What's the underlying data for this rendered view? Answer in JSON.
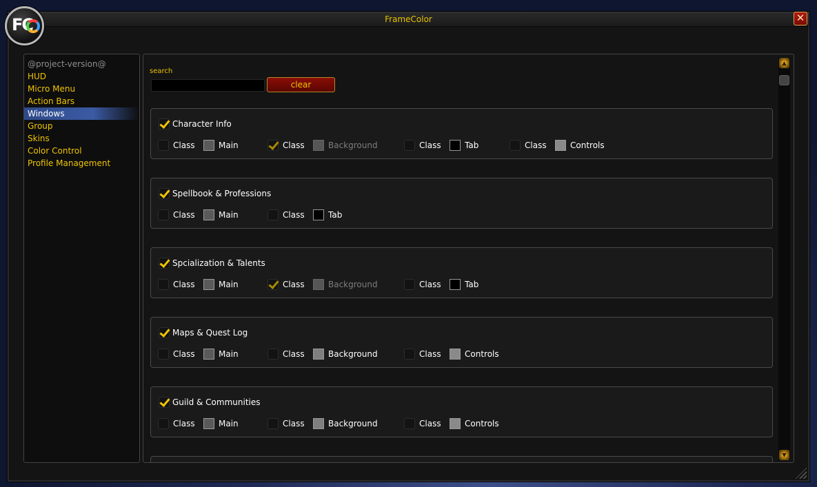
{
  "window": {
    "title": "FrameColor",
    "close_icon": "close-icon",
    "logo": "FC"
  },
  "sidebar": {
    "version": "@project-version@",
    "items": [
      {
        "label": "HUD",
        "selected": false
      },
      {
        "label": "Micro Menu",
        "selected": false
      },
      {
        "label": "Action Bars",
        "selected": false
      },
      {
        "label": "Windows",
        "selected": true
      },
      {
        "label": "Group",
        "selected": false
      },
      {
        "label": "Skins",
        "selected": false
      },
      {
        "label": "Color Control",
        "selected": false
      },
      {
        "label": "Profile Management",
        "selected": false
      }
    ]
  },
  "search": {
    "label": "search",
    "value": "",
    "clear_label": "clear"
  },
  "colors": {
    "accent_gold": "#f0c500",
    "swatch_main": "#5a5a5a",
    "swatch_background": "#7f7f7f",
    "swatch_tab": "#000000",
    "swatch_controls": "#8a8a8a"
  },
  "groups": [
    {
      "title": "Character Info",
      "checked": true,
      "options": [
        {
          "class_label": "Class",
          "class_checked": false,
          "color_label": "Main",
          "swatch": "#5a5a5a",
          "dim": false
        },
        {
          "class_label": "Class",
          "class_checked": true,
          "color_label": "Background",
          "swatch": "#7f7f7f",
          "dim": true
        },
        {
          "class_label": "Class",
          "class_checked": false,
          "color_label": "Tab",
          "swatch": "#000000",
          "dim": false
        },
        {
          "class_label": "Class",
          "class_checked": false,
          "color_label": "Controls",
          "swatch": "#8a8a8a",
          "dim": false
        }
      ]
    },
    {
      "title": "Spellbook & Professions",
      "checked": true,
      "options": [
        {
          "class_label": "Class",
          "class_checked": false,
          "color_label": "Main",
          "swatch": "#5a5a5a",
          "dim": false
        },
        {
          "class_label": "Class",
          "class_checked": false,
          "color_label": "Tab",
          "swatch": "#000000",
          "dim": false
        }
      ]
    },
    {
      "title": "Spcialization & Talents",
      "checked": true,
      "options": [
        {
          "class_label": "Class",
          "class_checked": false,
          "color_label": "Main",
          "swatch": "#5a5a5a",
          "dim": false
        },
        {
          "class_label": "Class",
          "class_checked": true,
          "color_label": "Background",
          "swatch": "#7f7f7f",
          "dim": true
        },
        {
          "class_label": "Class",
          "class_checked": false,
          "color_label": "Tab",
          "swatch": "#000000",
          "dim": false
        }
      ]
    },
    {
      "title": "Maps & Quest Log",
      "checked": true,
      "options": [
        {
          "class_label": "Class",
          "class_checked": false,
          "color_label": "Main",
          "swatch": "#5a5a5a",
          "dim": false
        },
        {
          "class_label": "Class",
          "class_checked": false,
          "color_label": "Background",
          "swatch": "#7f7f7f",
          "dim": false
        },
        {
          "class_label": "Class",
          "class_checked": false,
          "color_label": "Controls",
          "swatch": "#8a8a8a",
          "dim": false
        }
      ]
    },
    {
      "title": "Guild & Communities",
      "checked": true,
      "options": [
        {
          "class_label": "Class",
          "class_checked": false,
          "color_label": "Main",
          "swatch": "#5a5a5a",
          "dim": false
        },
        {
          "class_label": "Class",
          "class_checked": false,
          "color_label": "Background",
          "swatch": "#7f7f7f",
          "dim": false
        },
        {
          "class_label": "Class",
          "class_checked": false,
          "color_label": "Controls",
          "swatch": "#8a8a8a",
          "dim": false
        }
      ]
    }
  ],
  "scrollbar": {
    "up_icon": "arrow-up-icon",
    "down_icon": "arrow-down-icon"
  }
}
